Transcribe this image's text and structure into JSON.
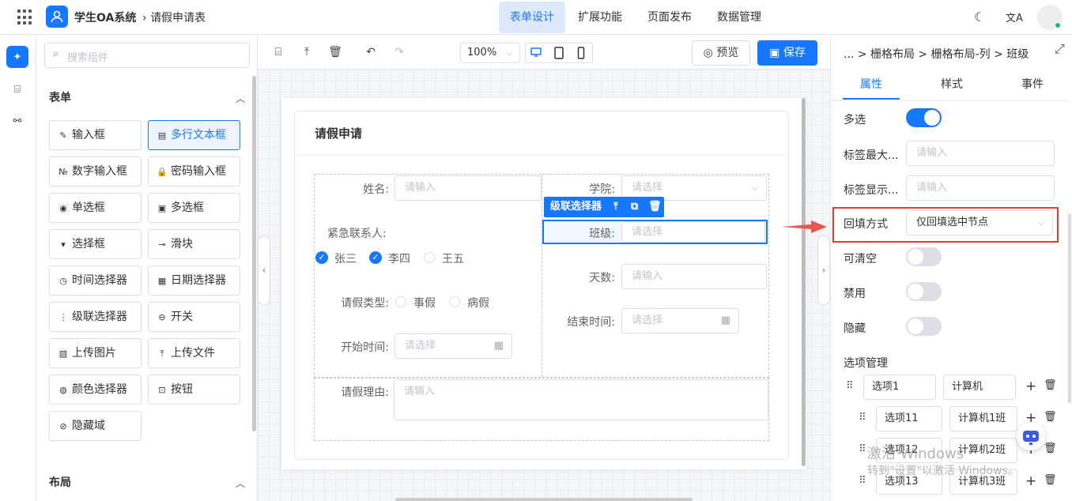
{
  "app": {
    "title": "学生OA系统",
    "breadcrumb": "请假申请表"
  },
  "nav": [
    "表单设计",
    "扩展功能",
    "页面发布",
    "数据管理"
  ],
  "component_panel": {
    "search_placeholder": "搜索组件",
    "form_section": "表单",
    "layout_section": "布局",
    "components": [
      {
        "label": "输入框",
        "icon": "✎"
      },
      {
        "label": "多行文本框",
        "icon": "▤"
      },
      {
        "label": "数字输入框",
        "icon": "№"
      },
      {
        "label": "密码输入框",
        "icon": "🔒"
      },
      {
        "label": "单选框",
        "icon": "◉"
      },
      {
        "label": "多选框",
        "icon": "▣"
      },
      {
        "label": "选择框",
        "icon": "▾"
      },
      {
        "label": "滑块",
        "icon": "⊸"
      },
      {
        "label": "时间选择器",
        "icon": "◷"
      },
      {
        "label": "日期选择器",
        "icon": "▦"
      },
      {
        "label": "级联选择器",
        "icon": "⋮"
      },
      {
        "label": "开关",
        "icon": "⊖"
      },
      {
        "label": "上传图片",
        "icon": "▨"
      },
      {
        "label": "上传文件",
        "icon": "⤒"
      },
      {
        "label": "颜色选择器",
        "icon": "◍"
      },
      {
        "label": "按钮",
        "icon": "⊡"
      },
      {
        "label": "隐藏域",
        "icon": "⊘"
      }
    ]
  },
  "toolbar": {
    "zoom": "100%",
    "preview": "预览",
    "save": "保存"
  },
  "form": {
    "title": "请假申请",
    "name_label": "姓名:",
    "name_placeholder": "请输入",
    "college_label": "学院:",
    "college_placeholder": "请选择",
    "contact_label": "紧急联系人:",
    "contacts": [
      {
        "label": "张三",
        "checked": true
      },
      {
        "label": "李四",
        "checked": true
      },
      {
        "label": "王五",
        "checked": false
      }
    ],
    "selected_widget": "级联选择器",
    "class_label": "班级:",
    "class_placeholder": "请选择",
    "days_label": "天数:",
    "days_placeholder": "请输入",
    "leave_type_label": "请假类型:",
    "leave_types": [
      "事假",
      "病假"
    ],
    "end_label": "结束时间:",
    "end_placeholder": "请选择",
    "start_label": "开始时间:",
    "start_placeholder": "请选择",
    "reason_label": "请假理由:",
    "reason_placeholder": "请输入"
  },
  "props": {
    "breadcrumb": "... > 栅格布局 > 栅格布局-列 > 班级",
    "tabs": [
      "属性",
      "样式",
      "事件"
    ],
    "multi_label": "多选",
    "multi_on": true,
    "tag_max_label": "标签最大...",
    "tag_max_placeholder": "请输入",
    "tag_show_label": "标签显示...",
    "tag_show_placeholder": "请输入",
    "fill_label": "回填方式",
    "fill_value": "仅回填选中节点",
    "clearable_label": "可清空",
    "disabled_label": "禁用",
    "hidden_label": "隐藏",
    "options_label": "选项管理",
    "options": [
      {
        "label": "选项1",
        "value": "计算机",
        "level": 0
      },
      {
        "label": "选项11",
        "value": "计算机1班",
        "level": 1
      },
      {
        "label": "选项12",
        "value": "计算机2班",
        "level": 1
      },
      {
        "label": "选项13",
        "value": "计算机3班",
        "level": 1
      }
    ]
  },
  "watermark": {
    "line1": "激活 Windows",
    "line2": "转到\"设置\"以激活 Windows。"
  },
  "colors": {
    "primary": "#1677ff",
    "highlight": "#e53935"
  }
}
